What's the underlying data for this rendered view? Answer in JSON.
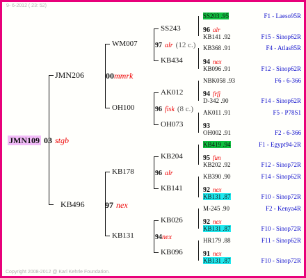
{
  "header": {
    "text": "9-  6-2012 ( 23: 52)"
  },
  "footer": {
    "text": "Copyright 2008-2012 @ Karl Kehrle Foundation."
  },
  "root": {
    "ring": "JMN109",
    "num": "03",
    "colour": "stgb"
  },
  "gen1": {
    "sire": {
      "ring": "JMN206",
      "num": "00",
      "colour": "mmrk"
    },
    "dam": {
      "ring": "KB496",
      "num": "97",
      "colour": "nex"
    }
  },
  "gen2": {
    "s_s": {
      "ring": "WM007",
      "num": "97",
      "colour": "alr",
      "count": "(12 c.)"
    },
    "s_d": {
      "ring": "OH100",
      "num": "96",
      "colour": "fisk",
      "count": "(8 c.)"
    },
    "d_s": {
      "ring": "KB178",
      "num": "96",
      "colour": "alr"
    },
    "d_d": {
      "ring": "KB131",
      "num": "94",
      "colour": "nex"
    }
  },
  "gen3": [
    {
      "ring": "SS243",
      "num": "96",
      "colour": "alr"
    },
    {
      "ring": "KB434",
      "num": "94",
      "colour": "nex"
    },
    {
      "ring": "AK012",
      "num": "94",
      "colour": "frfj"
    },
    {
      "ring": "OH073",
      "num": "93",
      "colour": ""
    },
    {
      "ring": "KB204",
      "num": "95",
      "colour": "fun"
    },
    {
      "ring": "KB141",
      "num": "92",
      "colour": "nex"
    },
    {
      "ring": "KB026",
      "num": "92",
      "colour": "nex"
    },
    {
      "ring": "KB096",
      "num": "91",
      "colour": "nex"
    }
  ],
  "gen4": [
    {
      "ring": "SS203 .95",
      "right": "F1 - Laeso95R"
    },
    {
      "ring": "KB141 .92",
      "right": "F15 - Sinop62R"
    },
    {
      "ring": "KB368 .91",
      "right": "F4 - Atlas85R"
    },
    {
      "ring": "KB096 .91",
      "right": "F12 - Sinop62R"
    },
    {
      "ring": "NBK058 .93",
      "right": "F6 - 6-366"
    },
    {
      "ring": "D-342 .90",
      "right": "F14 - Sinop62R"
    },
    {
      "ring": "AK011 .91",
      "right": "F5 - P78S1"
    },
    {
      "ring": "OH002 .91",
      "right": "F2 - 6-366"
    },
    {
      "ring": "KB419 .94",
      "right": "F1 - Egypt94-2R"
    },
    {
      "ring": "KB202 .92",
      "right": "F12 - Sinop72R"
    },
    {
      "ring": "KB390 .90",
      "right": "F14 - Sinop62R"
    },
    {
      "ring": "KB131 .87",
      "right": "F10 - Sinop72R"
    },
    {
      "ring": "M-245 .90",
      "right": "F2 - Kenya4R"
    },
    {
      "ring": "KB131 .87",
      "right": "F10 - Sinop72R"
    },
    {
      "ring": "HR179 .88",
      "right": "F11 - Sinop62R"
    },
    {
      "ring": "KB131 .87",
      "right": "F10 - Sinop72R"
    }
  ],
  "colors": {
    "frame": "#e8007a",
    "root_bg": "#f2bcf8",
    "green_hl": "#10c040",
    "cyan_hl": "#20e8ee",
    "link": "#1010cc",
    "colour_text": "#ee0000"
  }
}
